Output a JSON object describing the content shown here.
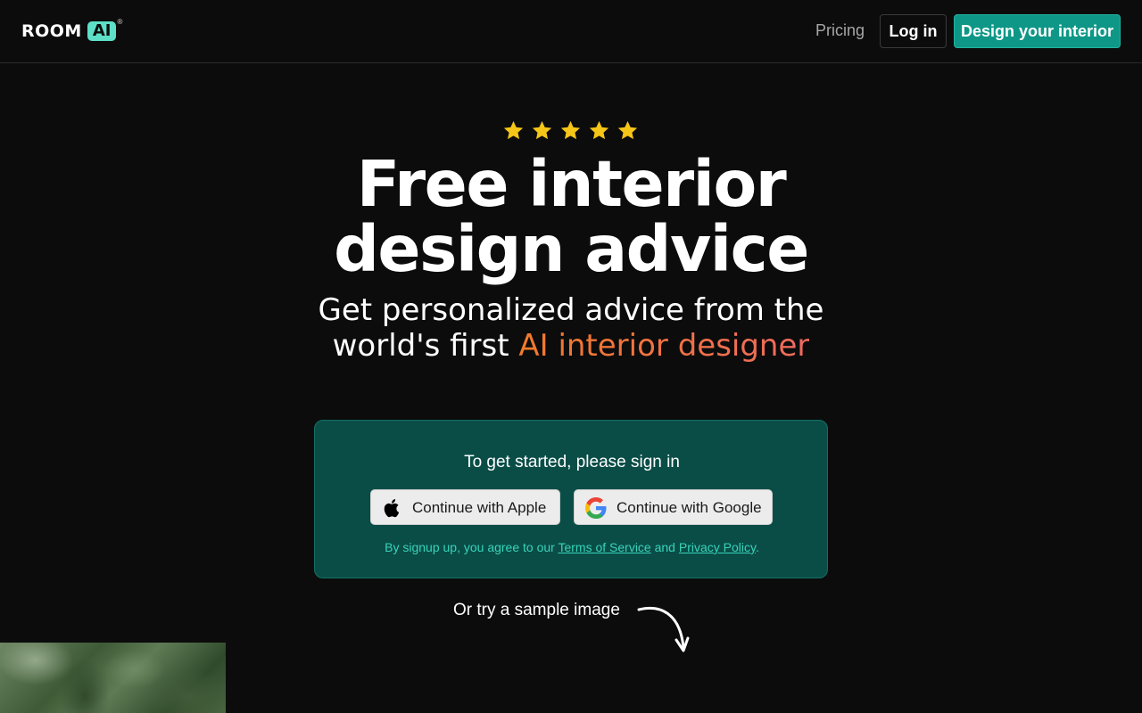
{
  "brand": {
    "word": "ROOM",
    "ai": "AI",
    "reg": "®"
  },
  "nav": {
    "pricing": "Pricing",
    "login": "Log in",
    "cta": "Design your interior"
  },
  "hero": {
    "rating_stars": 5,
    "headline_line1": "Free interior",
    "headline_line2": "design advice",
    "subhead_line1": "Get personalized advice from the",
    "subhead_line2_prefix": "world's first ",
    "subhead_accent": "AI interior designer"
  },
  "signin": {
    "prompt": "To get started, please sign in",
    "apple_label": "Continue with Apple",
    "google_label": "Continue with Google",
    "legal_prefix": "By signup up, you agree to our ",
    "terms": "Terms of Service",
    "legal_and": " and ",
    "privacy": "Privacy Policy",
    "legal_suffix": "."
  },
  "sample": {
    "label": "Or try a sample image"
  },
  "colors": {
    "background": "#0c0c0c",
    "brand_teal": "#5ee0c8",
    "cta_teal": "#0e9787",
    "card_bg": "#0a4d47",
    "star": "#f5c518",
    "accent_start": "#f27a2a",
    "accent_end": "#ef6a5e"
  },
  "icons": {
    "star": "star-icon",
    "apple": "apple-icon",
    "google": "google-icon",
    "arrow": "curved-arrow-icon"
  }
}
